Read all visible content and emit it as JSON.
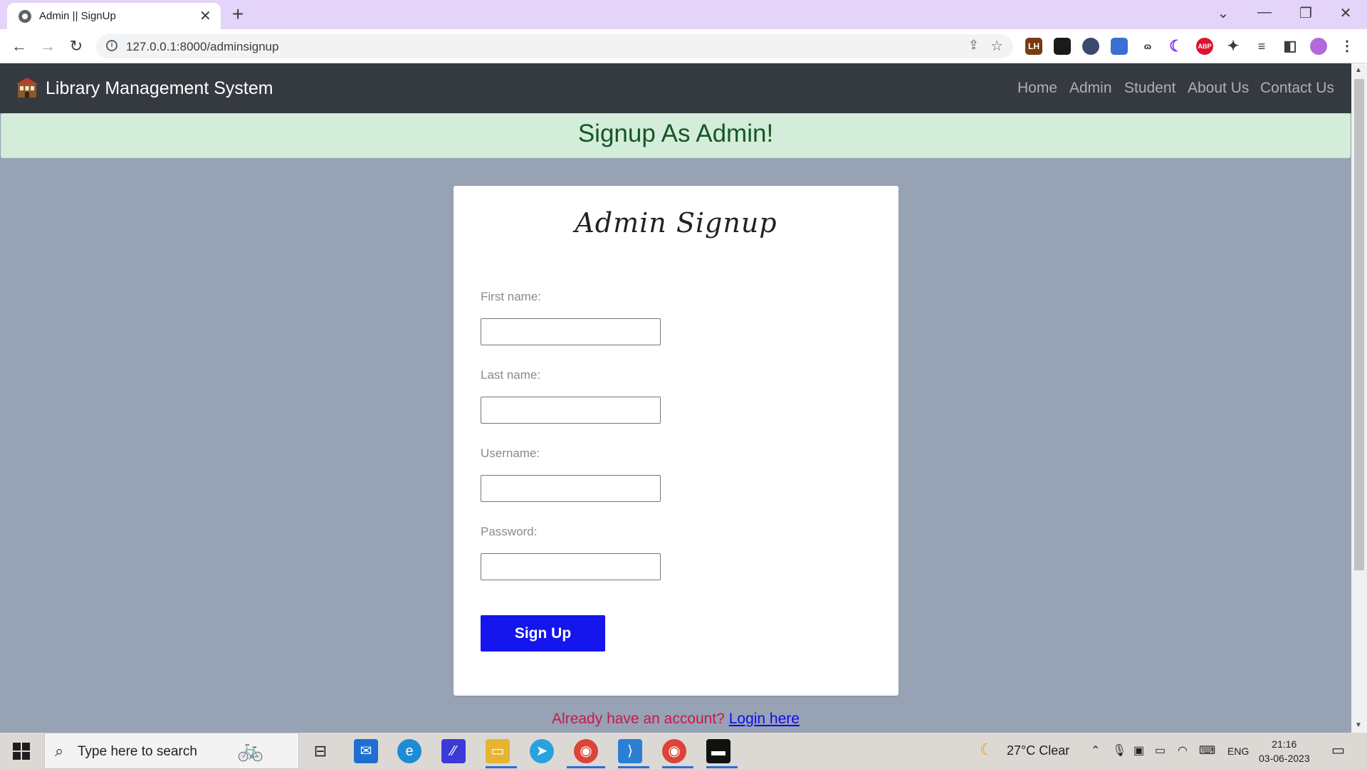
{
  "browser": {
    "tab_title": "Admin || SignUp",
    "url": "127.0.0.1:8000/adminsignup",
    "extensions": [
      {
        "name": "LH",
        "color": "#7a3a10"
      },
      {
        "name": "",
        "color": "#1a1a1a"
      },
      {
        "name": "",
        "color": "#3a4a6a"
      },
      {
        "name": "",
        "color": "#3b6fd1"
      },
      {
        "name": "ɷ",
        "color": "#ffffff"
      },
      {
        "name": "",
        "color": "#7b2ff7"
      },
      {
        "name": "ABP",
        "color": "#e0102f"
      }
    ]
  },
  "navbar": {
    "brand": "Library Management System",
    "links": [
      "Home",
      "Admin",
      "Student",
      "About Us",
      "Contact Us"
    ]
  },
  "alert": "Signup As Admin!",
  "form": {
    "title": "Admin Signup",
    "first_name_label": "First name:",
    "last_name_label": "Last name:",
    "username_label": "Username:",
    "password_label": "Password:",
    "submit_label": "Sign Up"
  },
  "footer": {
    "prompt": "Already have an account?",
    "link": "Login here"
  },
  "taskbar": {
    "search_placeholder": "Type here to search",
    "weather": "27°C  Clear",
    "language": "ENG",
    "time": "21:16",
    "date": "03-06-2023"
  }
}
